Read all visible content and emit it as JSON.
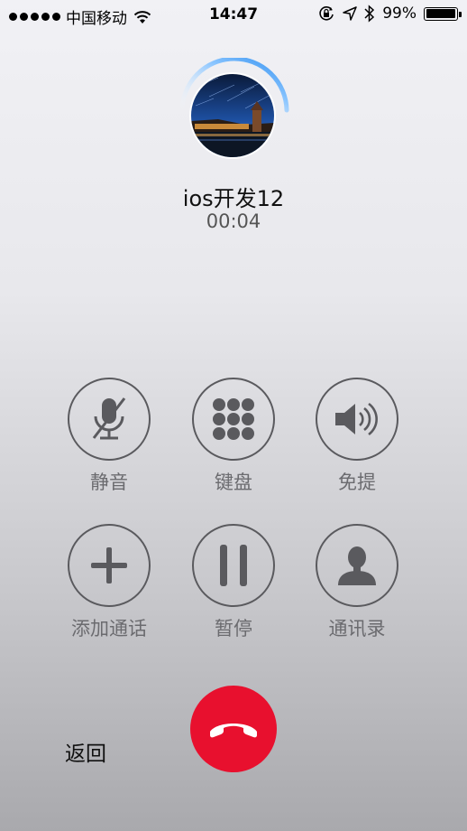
{
  "status_bar": {
    "carrier": "中国移动",
    "time": "14:47",
    "battery_percent": "99%",
    "battery_level": 0.99,
    "icons": [
      "signal-dots-icon",
      "wifi-icon",
      "orientation-lock-icon",
      "location-icon",
      "bluetooth-icon",
      "battery-icon"
    ]
  },
  "call": {
    "contact_name": "ios开发12",
    "duration": "00:04"
  },
  "controls": {
    "mute": {
      "label": "静音",
      "icon": "mute-microphone-icon"
    },
    "keypad": {
      "label": "键盘",
      "icon": "keypad-icon"
    },
    "speaker": {
      "label": "免提",
      "icon": "speaker-icon"
    },
    "add_call": {
      "label": "添加通话",
      "icon": "plus-icon"
    },
    "hold": {
      "label": "暂停",
      "icon": "pause-icon"
    },
    "contacts": {
      "label": "通讯录",
      "icon": "contact-person-icon"
    }
  },
  "footer": {
    "back_label": "返回",
    "end_call_icon": "hang-up-icon"
  },
  "colors": {
    "end_call": "#e8102e",
    "ring_accent": "#2f8ff0"
  }
}
